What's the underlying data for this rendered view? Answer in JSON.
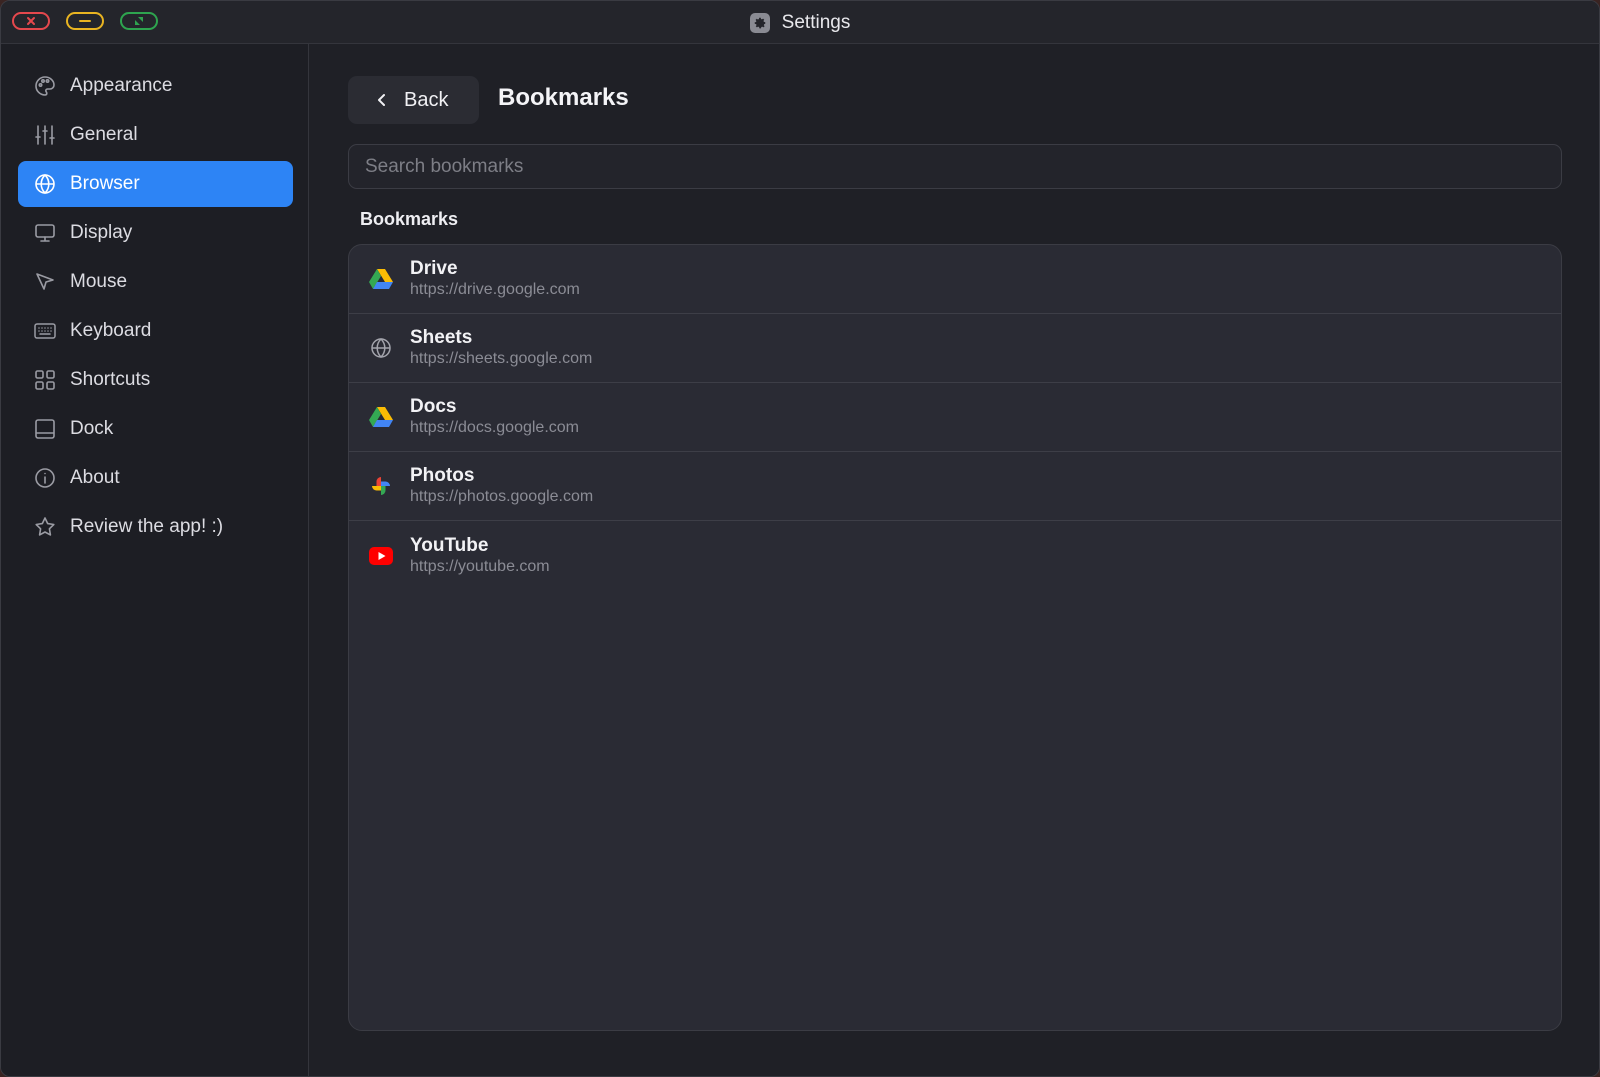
{
  "window": {
    "title": "Settings",
    "title_icon": "gear-icon"
  },
  "sidebar": {
    "items": [
      {
        "label": "Appearance",
        "icon": "palette-icon"
      },
      {
        "label": "General",
        "icon": "sliders-icon"
      },
      {
        "label": "Browser",
        "icon": "globe-icon",
        "active": true
      },
      {
        "label": "Display",
        "icon": "monitor-icon"
      },
      {
        "label": "Mouse",
        "icon": "cursor-icon"
      },
      {
        "label": "Keyboard",
        "icon": "keyboard-icon"
      },
      {
        "label": "Shortcuts",
        "icon": "grid-icon"
      },
      {
        "label": "Dock",
        "icon": "dock-icon"
      },
      {
        "label": "About",
        "icon": "info-icon"
      },
      {
        "label": "Review the app! :)",
        "icon": "star-icon"
      }
    ]
  },
  "main": {
    "back_label": "Back",
    "title": "Bookmarks",
    "search_placeholder": "Search bookmarks",
    "search_value": "",
    "section_label": "Bookmarks",
    "bookmarks": [
      {
        "name": "Drive",
        "url": "https://drive.google.com",
        "icon": "google-drive-icon"
      },
      {
        "name": "Sheets",
        "url": "https://sheets.google.com",
        "icon": "globe-icon"
      },
      {
        "name": "Docs",
        "url": "https://docs.google.com",
        "icon": "google-drive-icon"
      },
      {
        "name": "Photos",
        "url": "https://photos.google.com",
        "icon": "google-photos-icon"
      },
      {
        "name": "YouTube",
        "url": "https://youtube.com",
        "icon": "youtube-icon"
      }
    ]
  },
  "colors": {
    "accent": "#2d84f5",
    "close": "#e5484d",
    "minimize": "#e9b421",
    "maximize": "#2ea44f"
  }
}
